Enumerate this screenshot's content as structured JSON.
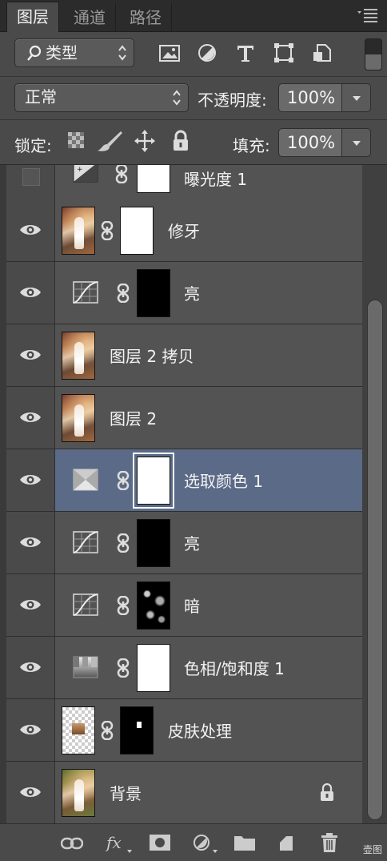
{
  "tabs": [
    "图层",
    "通道",
    "路径"
  ],
  "filter": {
    "label": "类型"
  },
  "blend_mode": "正常",
  "opacity": {
    "label": "不透明度:",
    "value": "100%"
  },
  "lock": {
    "label": "锁定:"
  },
  "fill": {
    "label": "填充:",
    "value": "100%"
  },
  "layers": [
    {
      "name": "曝光度 1",
      "visible": false
    },
    {
      "name": "修牙",
      "visible": true
    },
    {
      "name": "亮",
      "visible": true
    },
    {
      "name": "图层 2 拷贝",
      "visible": true
    },
    {
      "name": "图层 2",
      "visible": true
    },
    {
      "name": "选取颜色 1",
      "visible": true,
      "selected": true
    },
    {
      "name": "亮",
      "visible": true
    },
    {
      "name": "暗",
      "visible": true
    },
    {
      "name": "色相/饱和度 1",
      "visible": true
    },
    {
      "name": "皮肤处理",
      "visible": true
    },
    {
      "name": "背景",
      "visible": true,
      "locked": true
    }
  ],
  "watermark": "壶图",
  "colors": {
    "panel": "#4a4a4a",
    "selected": "#5a6a87",
    "tabbar": "#2b2b2b"
  }
}
